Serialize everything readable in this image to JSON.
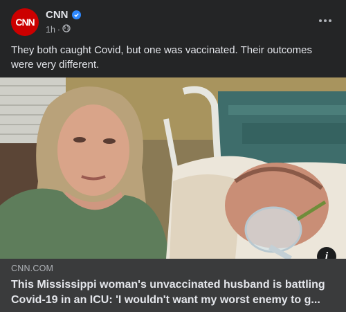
{
  "post": {
    "page_name": "CNN",
    "avatar_text": "CNN",
    "time": "1h",
    "separator": "·",
    "audience_icon": "globe-icon",
    "verified_icon": "verified-badge-icon",
    "menu_icon": "more-options-icon",
    "text": "They both caught Covid, but one was vaccinated. Their outcomes were very different."
  },
  "link": {
    "domain": "CNN.COM",
    "title_line1": "This Mississippi woman's unvaccinated husband is battling",
    "title_line2": "Covid-19 in an ICU: 'I wouldn't want my worst enemy to g...",
    "info_icon": "info-icon",
    "info_glyph": "i"
  },
  "colors": {
    "background": "#242526",
    "card": "#3a3b3c",
    "brand": "#cc0000",
    "verified": "#2d88ff"
  }
}
